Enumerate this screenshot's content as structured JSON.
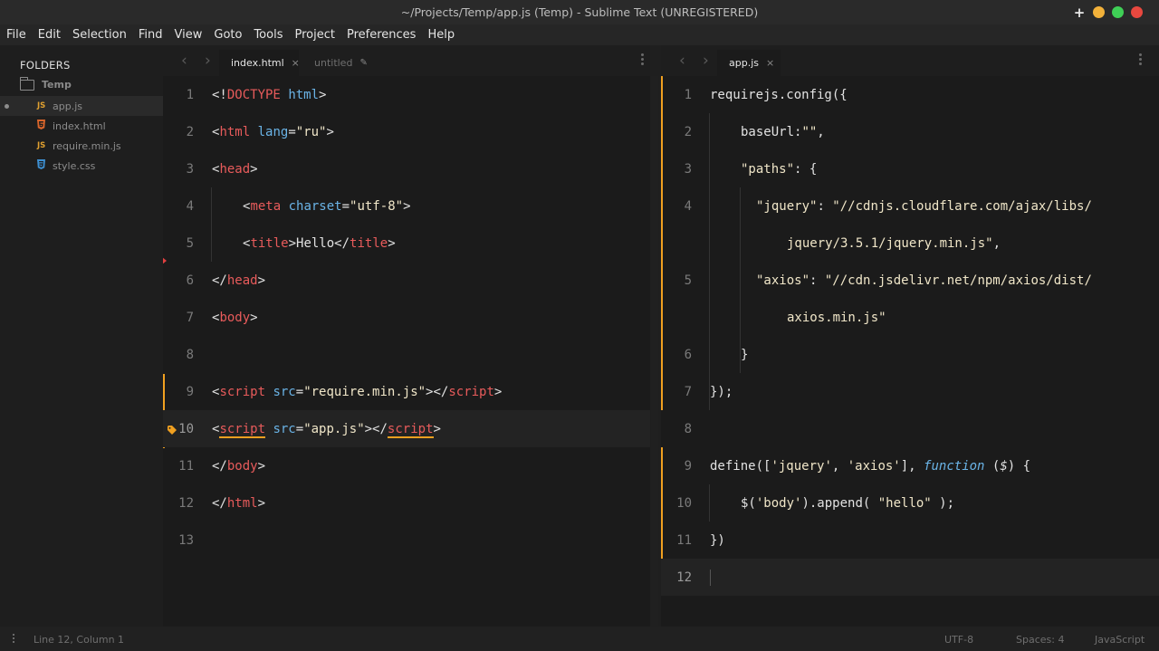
{
  "window": {
    "title": "~/Projects/Temp/app.js (Temp) - Sublime Text (UNREGISTERED)",
    "colors": {
      "close": "#f0c23c",
      "min": "#f2b13a",
      "max": "#3fcf56",
      "minimize_red": "#e8483f"
    }
  },
  "menu": [
    "File",
    "Edit",
    "Selection",
    "Find",
    "View",
    "Goto",
    "Tools",
    "Project",
    "Preferences",
    "Help"
  ],
  "sidebar": {
    "heading": "FOLDERS",
    "folder": "Temp",
    "files": [
      {
        "icon": "JS",
        "icon_color": "#e0a030",
        "name": "app.js",
        "active": true
      },
      {
        "icon": "5",
        "icon_color": "#d9652b",
        "name": "index.html",
        "active": false
      },
      {
        "icon": "JS",
        "icon_color": "#e0a030",
        "name": "require.min.js",
        "active": false
      },
      {
        "icon": "3",
        "icon_color": "#3d8fd1",
        "name": "style.css",
        "active": false
      }
    ]
  },
  "left_pane": {
    "tabs": [
      {
        "label": "index.html",
        "active": true
      },
      {
        "label": "untitled",
        "active": false
      }
    ],
    "line_numbers": [
      "1",
      "2",
      "3",
      "4",
      "5",
      "6",
      "7",
      "8",
      "9",
      "10",
      "11",
      "12",
      "13"
    ]
  },
  "right_pane": {
    "tabs": [
      {
        "label": "app.js",
        "active": true
      }
    ],
    "line_numbers": [
      "1",
      "2",
      "3",
      "4",
      "",
      "5",
      "",
      "6",
      "7",
      "8",
      "9",
      "10",
      "11",
      "12"
    ]
  },
  "status": {
    "position": "Line 12, Column 1",
    "encoding": "UTF-8",
    "indent": "Spaces: 4",
    "syntax": "JavaScript"
  }
}
